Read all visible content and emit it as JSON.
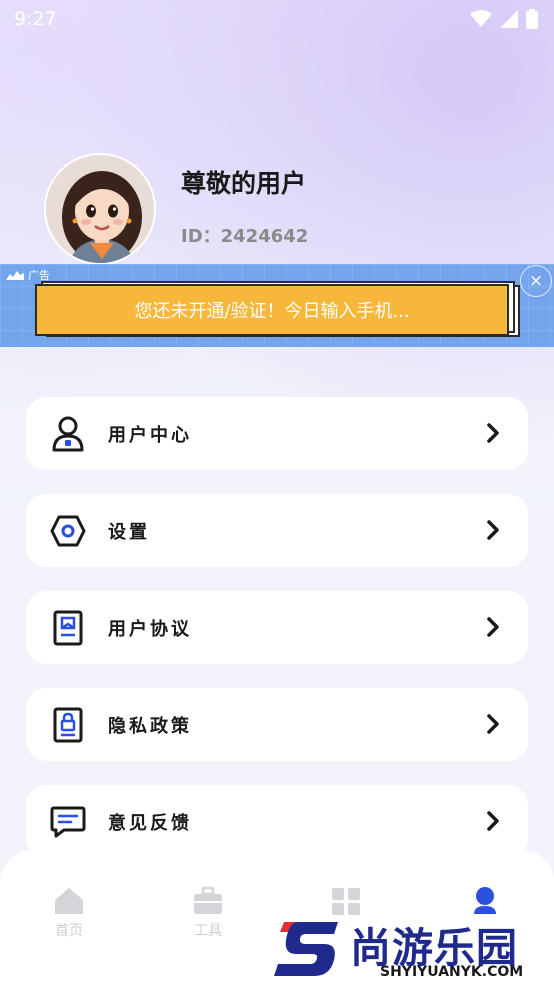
{
  "status_bar": {
    "time": "9:27"
  },
  "profile": {
    "username": "尊敬的用户",
    "user_id": "ID：2424642"
  },
  "ad": {
    "tag": "广告",
    "text": "您还未开通/验证！今日输入手机...",
    "close": "×"
  },
  "menu": [
    {
      "label": "用户中心",
      "icon": "user-icon"
    },
    {
      "label": "设置",
      "icon": "hexagon-settings-icon"
    },
    {
      "label": "用户协议",
      "icon": "document-user-icon"
    },
    {
      "label": "隐私政策",
      "icon": "document-lock-icon"
    },
    {
      "label": "意见反馈",
      "icon": "chat-message-icon"
    }
  ],
  "bottom_nav": [
    {
      "label": "首页",
      "icon": "home-icon"
    },
    {
      "label": "工具",
      "icon": "toolbox-icon"
    },
    {
      "label": "",
      "icon": "calculator-icon"
    },
    {
      "label": "",
      "icon": "profile-icon",
      "active": true
    }
  ],
  "watermark": {
    "brand": "尚游乐园",
    "url": "SHYIYUANYK.COM"
  },
  "colors": {
    "accent": "#2a50e0",
    "ad_bg": "#73a4ec",
    "ad_card": "#f7b73a"
  }
}
